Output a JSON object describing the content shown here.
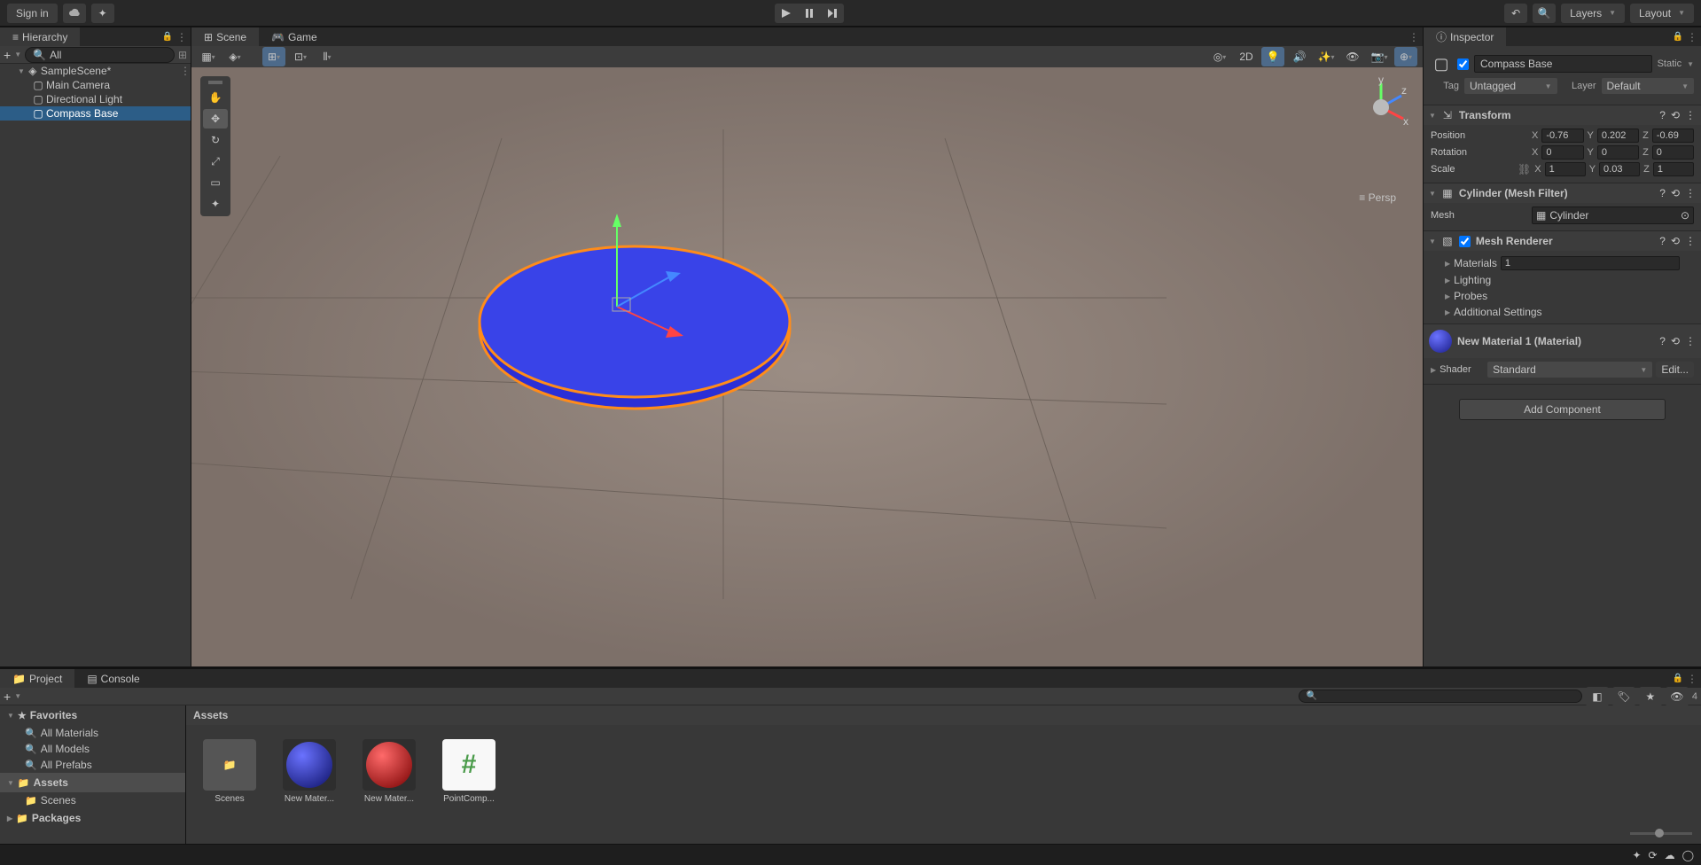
{
  "topbar": {
    "signin": "Sign in",
    "layers": "Layers",
    "layout": "Layout"
  },
  "hierarchy": {
    "title": "Hierarchy",
    "search_placeholder": "All",
    "scene": "SampleScene*",
    "items": [
      "Main Camera",
      "Directional Light",
      "Compass Base"
    ]
  },
  "tabs": {
    "scene": "Scene",
    "game": "Game",
    "inspector": "Inspector",
    "project": "Project",
    "console": "Console"
  },
  "scene_toolbar": {
    "mode2d": "2D",
    "persp": "Persp"
  },
  "inspector": {
    "name": "Compass Base",
    "static": "Static",
    "tag_label": "Tag",
    "tag_value": "Untagged",
    "layer_label": "Layer",
    "layer_value": "Default",
    "transform": {
      "title": "Transform",
      "position_label": "Position",
      "rotation_label": "Rotation",
      "scale_label": "Scale",
      "pos": {
        "x": "-0.76",
        "y": "0.202",
        "z": "-0.69"
      },
      "rot": {
        "x": "0",
        "y": "0",
        "z": "0"
      },
      "scale": {
        "x": "1",
        "y": "0.03",
        "z": "1"
      }
    },
    "mesh_filter": {
      "title": "Cylinder (Mesh Filter)",
      "mesh_label": "Mesh",
      "mesh_value": "Cylinder"
    },
    "mesh_renderer": {
      "title": "Mesh Renderer",
      "materials": "Materials",
      "materials_count": "1",
      "lighting": "Lighting",
      "probes": "Probes",
      "additional": "Additional Settings"
    },
    "material": {
      "title": "New Material 1 (Material)",
      "shader_label": "Shader",
      "shader_value": "Standard",
      "edit": "Edit..."
    },
    "add_component": "Add Component"
  },
  "project": {
    "favorites": "Favorites",
    "fav_items": [
      "All Materials",
      "All Models",
      "All Prefabs"
    ],
    "assets": "Assets",
    "assets_items": [
      "Scenes"
    ],
    "packages": "Packages",
    "breadcrumb": "Assets",
    "count": "4",
    "grid_items": [
      "Scenes",
      "New Mater...",
      "New Mater...",
      "PointComp..."
    ]
  }
}
